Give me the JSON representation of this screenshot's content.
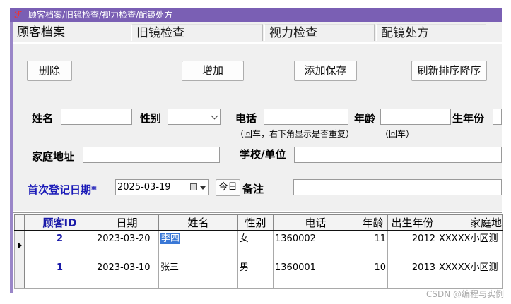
{
  "window": {
    "title": "顾客档案/旧镜检查/视力检查/配镜处方"
  },
  "tabs": [
    {
      "label": "顾客档案"
    },
    {
      "label": "旧镜检查"
    },
    {
      "label": "视力检查"
    },
    {
      "label": "配镜处方"
    }
  ],
  "toolbar": {
    "delete_label": "删除",
    "add_label": "增加",
    "save_label": "添加保存",
    "refresh_label": "刷新排序降序"
  },
  "form": {
    "name_label": "姓名",
    "gender_label": "性别",
    "phone_label": "电话",
    "age_label": "年龄",
    "birth_year_label": "生年份",
    "phone_hint": "（回车，右下角显示是否重复）",
    "age_hint": "（回车）",
    "address_label": "家庭地址",
    "school_label": "学校/单位",
    "first_date_label": "首次登记日期*",
    "first_date_value": "2025-03-19",
    "today_label": "今日",
    "remark_label": "备注"
  },
  "grid": {
    "columns": [
      "顾客ID",
      "日期",
      "姓名",
      "性别",
      "电话",
      "年龄",
      "出生年份",
      "家庭地"
    ],
    "rows": [
      {
        "id": "2",
        "date": "2023-03-20",
        "name": "李四",
        "gender": "女",
        "phone": "1360002",
        "age": "11",
        "birth_year": "2012",
        "address": "XXXXX小区测"
      },
      {
        "id": "1",
        "date": "2023-03-10",
        "name": "张三",
        "gender": "男",
        "phone": "1360001",
        "age": "10",
        "birth_year": "2013",
        "address": "XXXXX小区测"
      }
    ]
  },
  "watermark": "CSDN @编程与实例",
  "colors": {
    "titlebar": "#7a5fb4",
    "first_date_label": "#1a1ab8",
    "selection": "#3a78d6"
  }
}
